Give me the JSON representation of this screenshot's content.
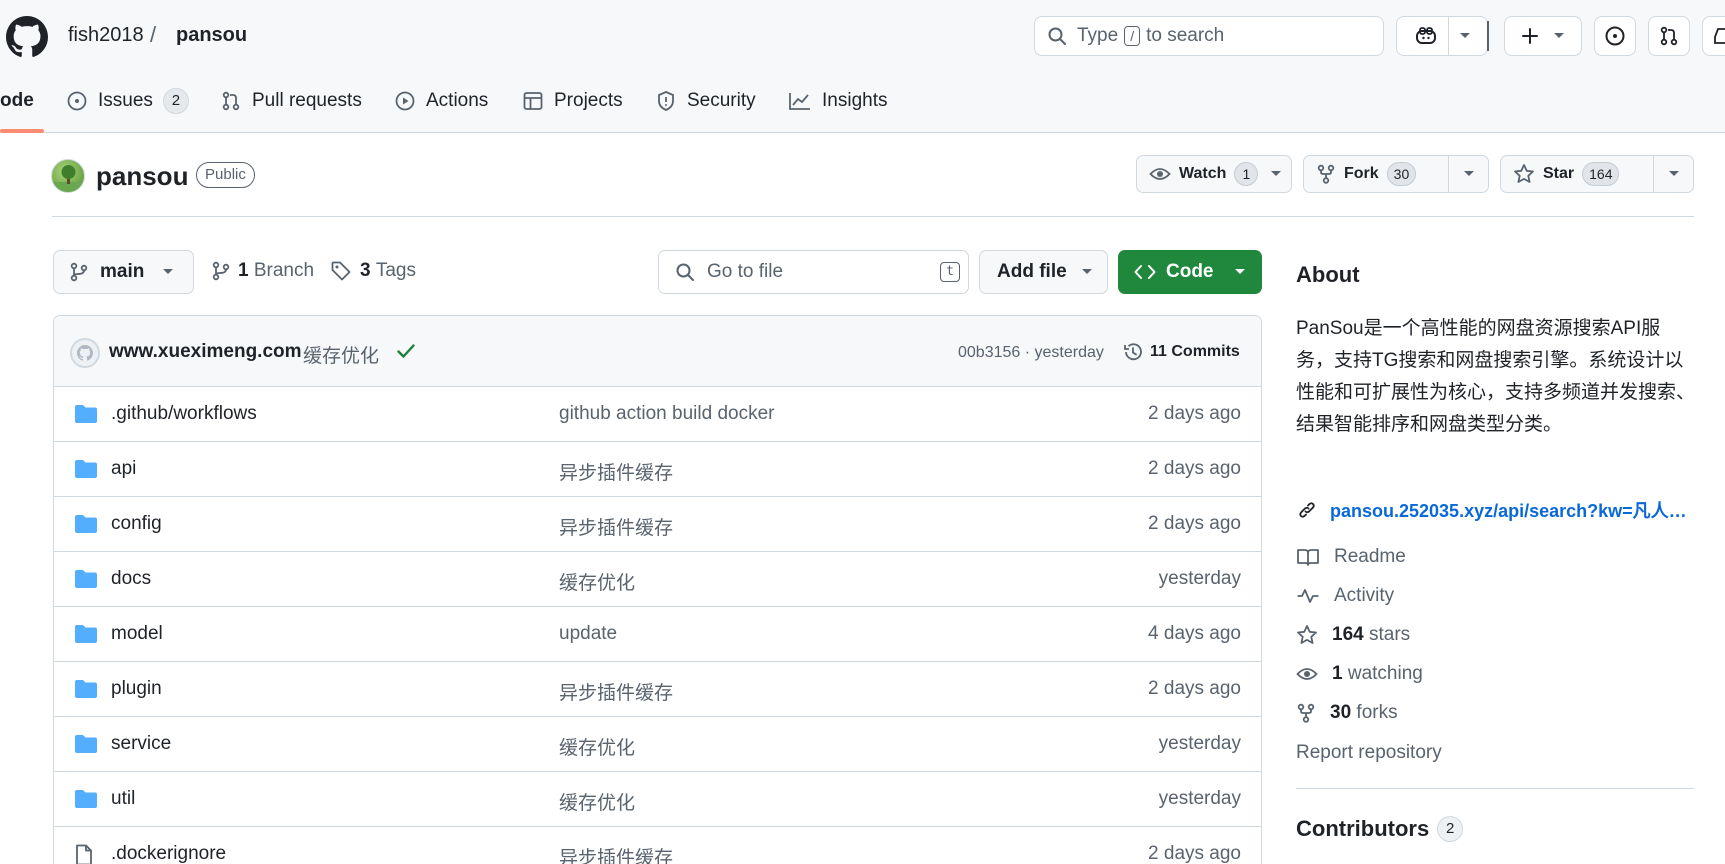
{
  "header": {
    "owner": "fish2018",
    "separator": "/",
    "repo": "pansou",
    "search": {
      "prefix": "Type",
      "key": "/",
      "suffix": "to search"
    }
  },
  "tabs": [
    {
      "label": "ode",
      "icon": "code-icon"
    },
    {
      "label": "Issues",
      "count": "2",
      "icon": "issue-icon"
    },
    {
      "label": "Pull requests",
      "icon": "pull-request-icon"
    },
    {
      "label": "Actions",
      "icon": "play-icon"
    },
    {
      "label": "Projects",
      "icon": "table-icon"
    },
    {
      "label": "Security",
      "icon": "shield-icon"
    },
    {
      "label": "Insights",
      "icon": "graph-icon"
    }
  ],
  "repo": {
    "name": "pansou",
    "visibility": "Public",
    "watch": {
      "label": "Watch",
      "count": "1"
    },
    "fork": {
      "label": "Fork",
      "count": "30"
    },
    "star": {
      "label": "Star",
      "count": "164"
    }
  },
  "toolbar": {
    "branch": "main",
    "branches_count": "1",
    "branches_label": "Branch",
    "tags_count": "3",
    "tags_label": "Tags",
    "goto_placeholder": "Go to file",
    "goto_key": "t",
    "add_file": "Add file",
    "code": "Code"
  },
  "latest_commit": {
    "author": "www.xueximeng.com",
    "message": "缓存优化",
    "sha_time": "00b3156 · yesterday",
    "commits": "11 Commits"
  },
  "files": [
    {
      "type": "folder",
      "name": ".github/workflows",
      "message": "github action build docker",
      "date": "2 days ago"
    },
    {
      "type": "folder",
      "name": "api",
      "message": "异步插件缓存",
      "date": "2 days ago"
    },
    {
      "type": "folder",
      "name": "config",
      "message": "异步插件缓存",
      "date": "2 days ago"
    },
    {
      "type": "folder",
      "name": "docs",
      "message": "缓存优化",
      "date": "yesterday"
    },
    {
      "type": "folder",
      "name": "model",
      "message": "update",
      "date": "4 days ago"
    },
    {
      "type": "folder",
      "name": "plugin",
      "message": "异步插件缓存",
      "date": "2 days ago"
    },
    {
      "type": "folder",
      "name": "service",
      "message": "缓存优化",
      "date": "yesterday"
    },
    {
      "type": "folder",
      "name": "util",
      "message": "缓存优化",
      "date": "yesterday"
    },
    {
      "type": "file",
      "name": ".dockerignore",
      "message": "异步插件缓存",
      "date": "2 days ago"
    }
  ],
  "about": {
    "title": "About",
    "description": "PanSou是一个高性能的网盘资源搜索API服务，支持TG搜索和网盘搜索引擎。系统设计以性能和可扩展性为核心，支持多频道并发搜索、结果智能排序和网盘类型分类。",
    "link": "pansou.252035.xyz/api/search?kw=凡人…",
    "readme": "Readme",
    "activity": "Activity",
    "stars_count": "164",
    "stars_label": "stars",
    "watching_count": "1",
    "watching_label": "watching",
    "forks_count": "30",
    "forks_label": "forks",
    "report": "Report repository",
    "contributors": "Contributors",
    "contributors_count": "2"
  },
  "colors": {
    "accent_green": "#1f883d",
    "link_blue": "#0969da",
    "folder_blue": "#54aeff",
    "tab_underline": "#fd8c73"
  }
}
